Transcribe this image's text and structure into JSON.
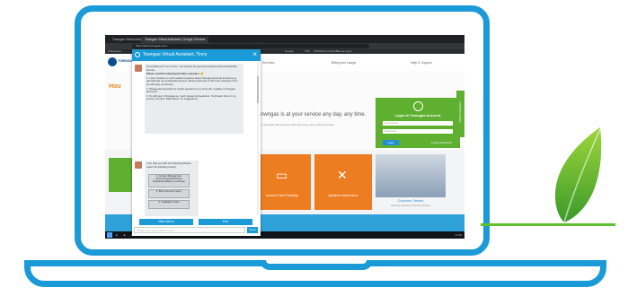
{
  "browser": {
    "tabs": [
      "Towngas Virtual Assi...",
      "Towngas Virtual Assistant | Google Chrome"
    ],
    "url": "https://www.towngas.com/...",
    "bookmarks": [
      "Whitepaper",
      "Google",
      "TDC",
      "TOWNGAS ONLINE",
      "Kinetic Apps"
    ]
  },
  "site": {
    "logo_text": "TOWNGAS",
    "nav": [
      "Services",
      "Billing and Usage",
      "Help & Support"
    ],
    "page_title": "Hou",
    "tagline": "Towngas is at your service any day, any time.",
    "subtag": "Join Towngas with just one click and enjoy more online services!",
    "login": {
      "title": "Login to Towngas Account",
      "username_placeholder": "User Name",
      "password_placeholder": "Password",
      "login_button": "Login",
      "forgot": "Forgot Password"
    },
    "tiles": [
      {
        "label": "Account Online Readings",
        "icon": "meter-icon"
      },
      {
        "label": "Appliance Maintenance",
        "icon": "tools-icon"
      }
    ],
    "photo_caption": "Customer Centres",
    "photo_sub": "Visit Our Customer Service Centres",
    "feedback": "Online Feedback",
    "taskbar_time": "17:40"
  },
  "chat": {
    "title": "Towngas Virtual Assistant, Tinny",
    "greeting": "Good afternoon! I am Tinny. I can answer the general enquiries about Residential Service.",
    "notice_title": "Please read the following friendly reminders. 😊",
    "reminders": [
      "1. I won't answer on such related enquiries about Towngas personal account (e.g. gas bill) and non-residential services. Please click here to fill in the e-Enquiry form. we will reply you shortly.",
      "2. Please ask keywords for simple questions (e.g. How can I register a Towngas account?)",
      "3. It's still new to Towngas so I can't answer all questions. You'll learn them in my journey. Number \"Main Menu\" for suggestions."
    ],
    "menu_prompt": "I can help you with the following (Please select the following button):",
    "options": [
      "1. Account Management (Open/Terminate/Change Registration/Billing & Learning)",
      "2. Bill & Payment Inquiry",
      "3. Installation Guide"
    ],
    "main_menu_button": "Main Menu",
    "exit_button": "Exit",
    "input_placeholder": "Please type your question here",
    "send_button": "Send"
  }
}
